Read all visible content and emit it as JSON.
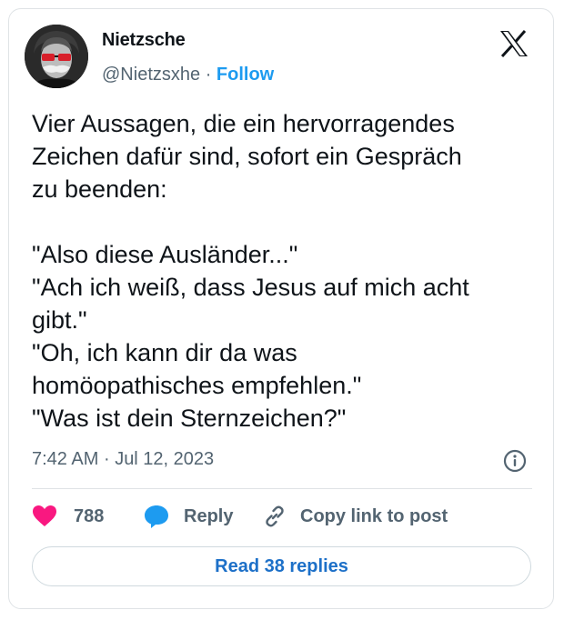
{
  "author": {
    "name": "Nietzsche",
    "handle": "@Nietzsxhe",
    "separator": "·",
    "follow_label": "Follow"
  },
  "tweet": {
    "text": "Vier Aussagen, die ein hervorragendes\nZeichen dafür sind, sofort ein Gespräch\nzu beenden:\n\n\"Also diese Ausländer...\"\n\"Ach ich weiß, dass Jesus auf mich acht\ngibt.\"\n\"Oh, ich kann dir da was\nhomöopathisches empfehlen.\"\n\"Was ist dein Sternzeichen?\"",
    "time": "7:42 AM",
    "separator": "·",
    "date": "Jul 12, 2023"
  },
  "actions": {
    "likes_count": "788",
    "reply_label": "Reply",
    "copy_link_label": "Copy link to post"
  },
  "read_replies_label": "Read 38 replies",
  "icons": {
    "brand": "x-logo-icon",
    "info": "info-icon",
    "like": "heart-icon",
    "reply": "speech-bubble-icon",
    "link": "link-icon"
  },
  "colors": {
    "like": "#f91880",
    "reply": "#1d9bf0",
    "follow": "#1d9bf0",
    "link_button": "#1d70c8"
  }
}
